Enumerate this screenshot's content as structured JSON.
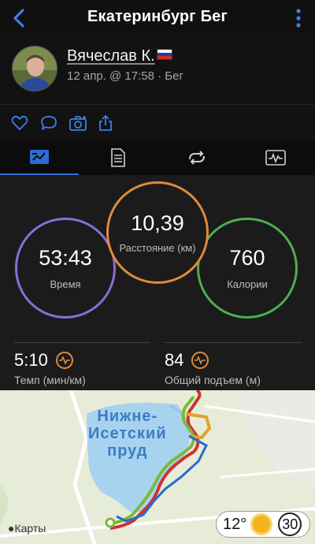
{
  "header": {
    "title": "Екатеринбург Бег"
  },
  "profile": {
    "name": "Вячеслав К.",
    "meta": "12 апр. @ 17:58 · Бег"
  },
  "actions": [
    "heart-icon",
    "comment-icon",
    "camera-icon",
    "share-icon"
  ],
  "tabs": [
    {
      "icon": "summary-icon",
      "active": true
    },
    {
      "icon": "details-icon",
      "active": false
    },
    {
      "icon": "laps-icon",
      "active": false
    },
    {
      "icon": "chart-icon",
      "active": false
    }
  ],
  "stats": {
    "time": {
      "value": "53:43",
      "label": "Время"
    },
    "distance": {
      "value": "10,39",
      "label": "Расстояние (км)"
    },
    "calories": {
      "value": "760",
      "label": "Калории"
    },
    "pace": {
      "value": "5:10",
      "label": "Темп (мин/км)"
    },
    "ascent": {
      "value": "84",
      "label": "Общий подъем (м)"
    }
  },
  "map": {
    "place_label": "Нижне-\nИсетский\nпруд",
    "attribution": "Карты",
    "weather": {
      "temp": "12°",
      "badge": "30"
    }
  },
  "colors": {
    "accent": "#2e6bd6",
    "time": "#8a6ed8",
    "distance": "#e08a3c",
    "calories": "#4caf50"
  }
}
